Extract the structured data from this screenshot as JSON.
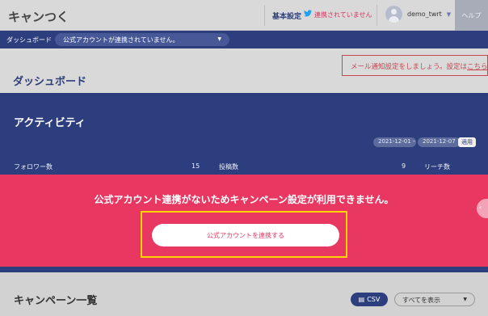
{
  "header": {
    "logo": "キャンつく",
    "basic_settings": "基本設定",
    "twitter_icon": "twitter-icon",
    "twitter_status": "連携されていません",
    "username": "demo_twrt",
    "help": "ヘルプ"
  },
  "subnav": {
    "breadcrumb": "ダッシュボード",
    "account_select": "公式アカウントが連携されていません。"
  },
  "dashboard": {
    "title": "ダッシュボード",
    "notice_text": "メール通知設定をしましょう。設定は",
    "notice_link": "こちら"
  },
  "activity": {
    "title": "アクティビティ",
    "date_from": "2021-12-01",
    "date_separator": "-",
    "date_to": "2021-12-07",
    "apply": "適用",
    "stats": {
      "followers_label": "フォロワー数",
      "followers_value": "15",
      "posts_label": "投稿数",
      "posts_value": "9",
      "reach_label": "リーチ数"
    }
  },
  "overlay": {
    "message": "公式アカウント連携がないためキャンペーン設定が利用できません。",
    "connect_button": "公式アカウントを連携する",
    "highlight_color": "#ffd400",
    "background_color": "#e83862"
  },
  "campaigns": {
    "title": "キャンペーン一覧",
    "csv_button": "CSV",
    "filter_value": "すべてを表示"
  },
  "colors": {
    "brand_navy": "#2c3e7d",
    "alert_red": "#c8454f"
  }
}
